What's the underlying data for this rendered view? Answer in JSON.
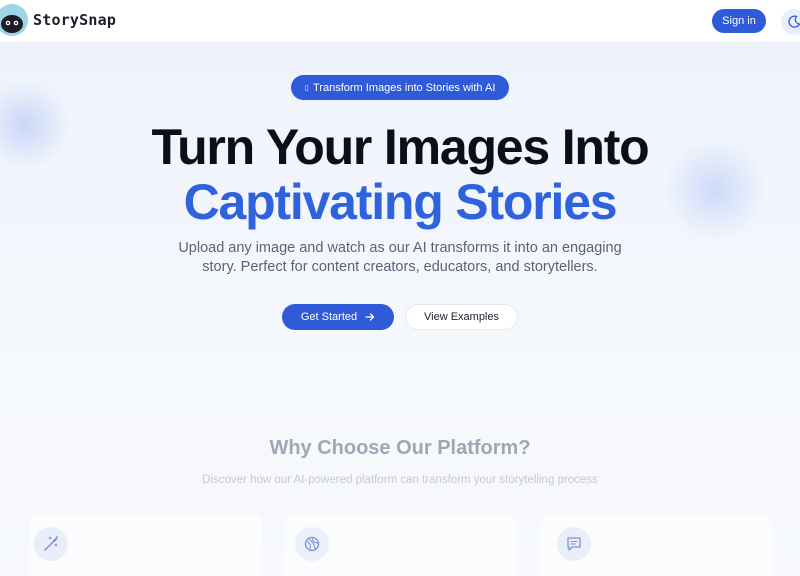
{
  "header": {
    "brand": "StorySnap",
    "signin_label": "Sign in"
  },
  "hero": {
    "pill_text": "Transform Images into Stories with AI",
    "title_line1": "Turn Your Images Into",
    "title_line2": "Captivating Stories",
    "subtitle_line1": "Upload any image and watch as our AI transforms it into an engaging",
    "subtitle_line2": "story. Perfect for content creators, educators, and storytellers.",
    "cta_primary": "Get Started",
    "cta_secondary": "View Examples"
  },
  "features": {
    "title": "Why Choose Our Platform?",
    "subtitle": "Discover how our AI-powered platform can transform your storytelling process",
    "icons": [
      "magic-wand-icon",
      "globe-icon",
      "chat-icon"
    ]
  },
  "colors": {
    "accent": "#2f5bd8",
    "title_accent": "#2f63dd",
    "text_dark": "#0b0f19",
    "text_muted": "#5b6475"
  }
}
